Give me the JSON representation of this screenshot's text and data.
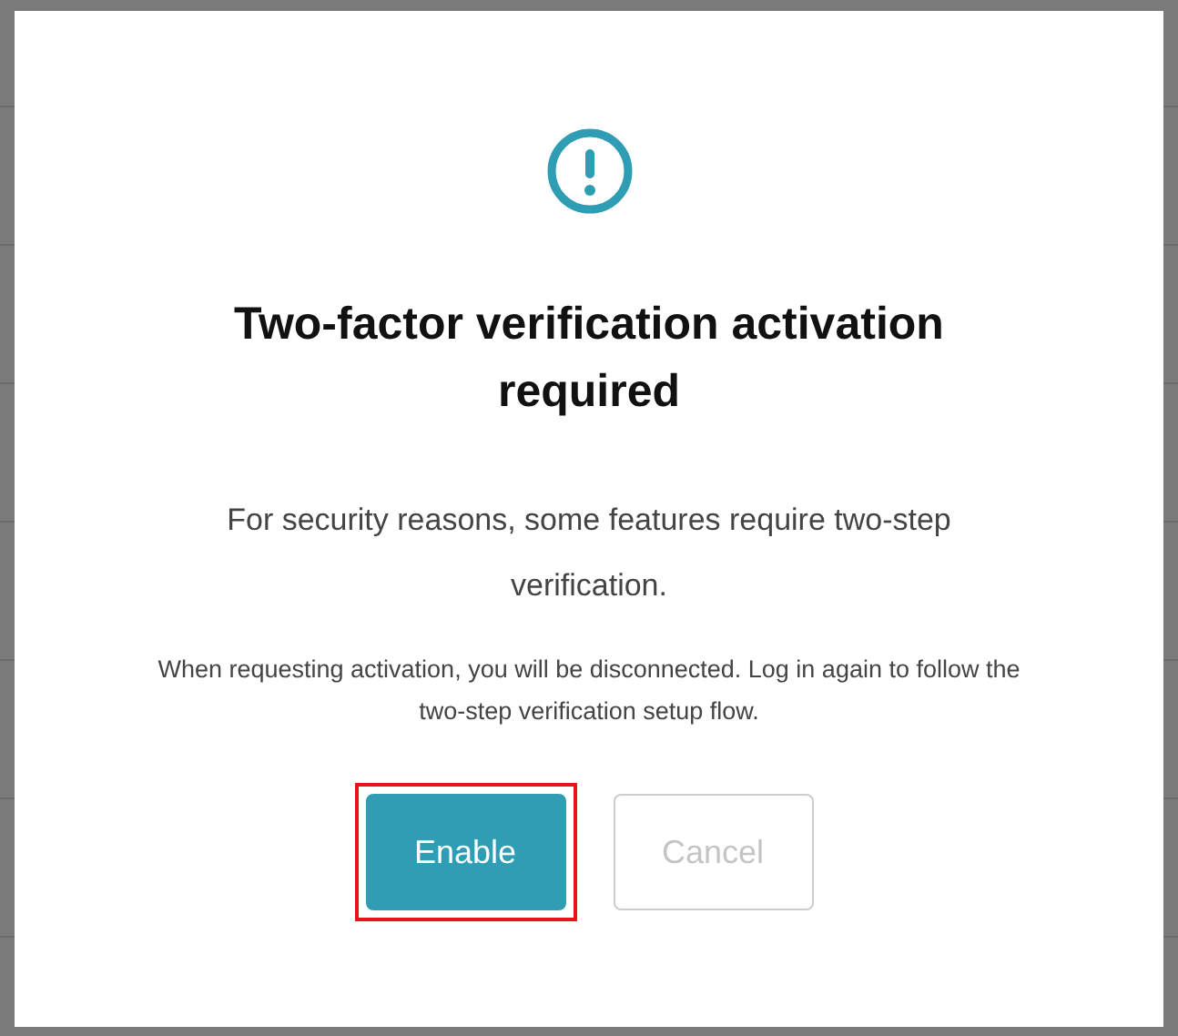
{
  "dialog": {
    "title": "Two-factor verification activation required",
    "message": "For security reasons, some features require two-step verification.",
    "note": "When requesting activation, you will be disconnected. Log in again to follow the two-step verification setup flow.",
    "buttons": [
      {
        "label": "Enable",
        "kind": "primary",
        "highlighted": true,
        "disabled": false
      },
      {
        "label": "Cancel",
        "kind": "secondary",
        "highlighted": false,
        "disabled": true
      }
    ]
  }
}
